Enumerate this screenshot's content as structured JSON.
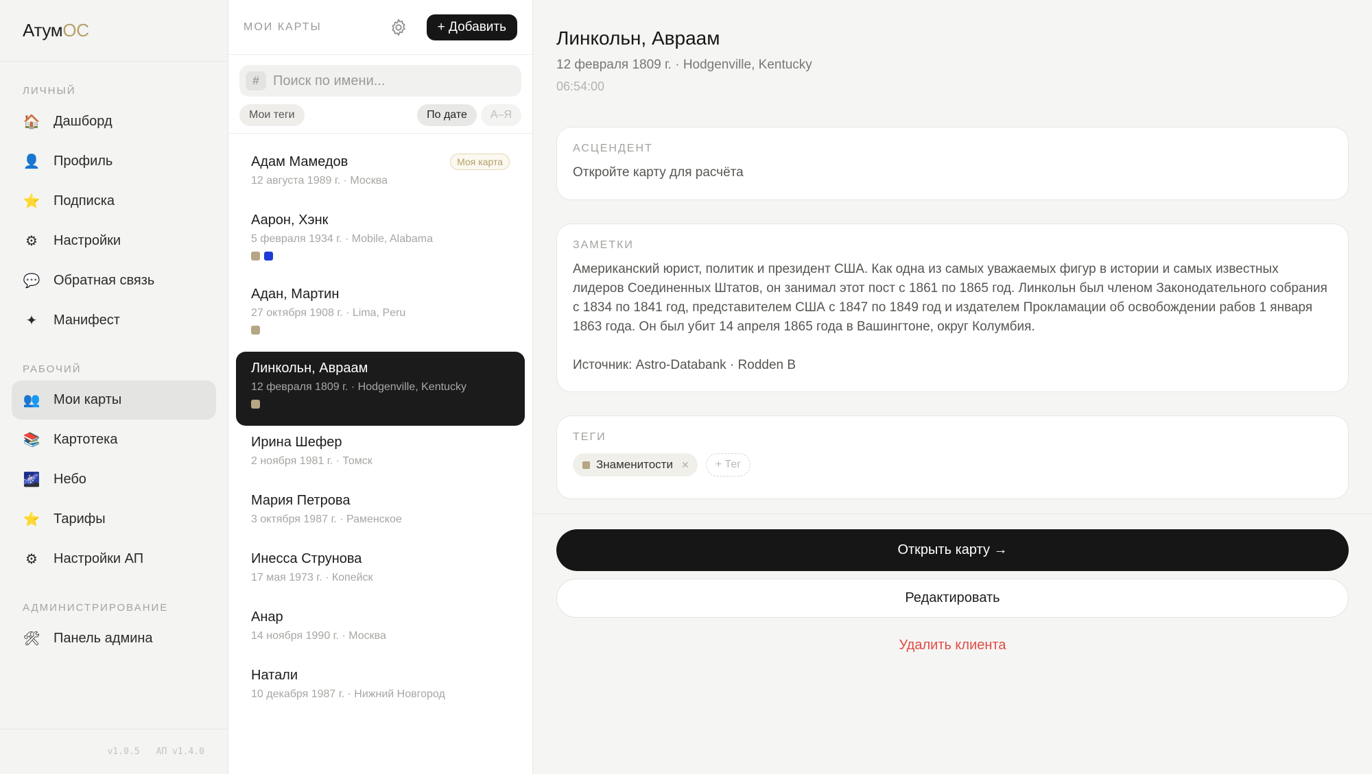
{
  "app": {
    "logo_main": "Атум",
    "logo_accent": "ОС",
    "accent_color": "#b5a06a"
  },
  "sidebar": {
    "sections": [
      {
        "label": "ЛИЧНЫЙ",
        "items": [
          {
            "label": "Дашборд",
            "icon": "house-icon"
          },
          {
            "label": "Профиль",
            "icon": "person-icon"
          },
          {
            "label": "Подписка",
            "icon": "star-icon"
          },
          {
            "label": "Настройки",
            "icon": "gear-icon"
          },
          {
            "label": "Обратная связь",
            "icon": "speech-bubble-icon"
          },
          {
            "label": "Манифест",
            "icon": "sparkle-icon"
          }
        ]
      },
      {
        "label": "РАБОЧИЙ",
        "items": [
          {
            "label": "Мои карты",
            "icon": "people-icon",
            "active": true
          },
          {
            "label": "Картотека",
            "icon": "books-icon"
          },
          {
            "label": "Небо",
            "icon": "night-sky-icon"
          },
          {
            "label": "Тарифы",
            "icon": "star-icon"
          },
          {
            "label": "Настройки АП",
            "icon": "gear-icon"
          }
        ]
      },
      {
        "label": "АДМИНИСТРИРОВАНИЕ",
        "items": [
          {
            "label": "Панель админа",
            "icon": "tools-icon"
          }
        ]
      }
    ],
    "version": "v1.0.5",
    "ap_version": "АП v1.4.0"
  },
  "list": {
    "title": "МОИ КАРТЫ",
    "add_label": "+ Добавить",
    "search_placeholder": "Поиск по имени...",
    "filter_tags": "Мои теги",
    "sort_date": "По дате",
    "sort_az": "А–Я",
    "my_card_badge": "Моя карта",
    "items": [
      {
        "name": "Адам Мамедов",
        "meta": "12 августа 1989 г. · Москва",
        "badge": true,
        "tags": []
      },
      {
        "name": "Аарон, Хэнк",
        "meta": "5 февраля 1934 г. · Mobile, Alabama",
        "tags": [
          "#b5a685",
          "#1f3bd6"
        ]
      },
      {
        "name": "Адан, Мартин",
        "meta": "27 октября 1908 г. · Lima, Peru",
        "tags": [
          "#b5a685"
        ]
      },
      {
        "name": "Линкольн, Авраам",
        "meta": "12 февраля 1809 г. · Hodgenville, Kentucky",
        "tags": [
          "#b5a685"
        ],
        "selected": true
      },
      {
        "name": "Ирина Шефер",
        "meta": "2 ноября 1981 г. · Томск",
        "tags": []
      },
      {
        "name": "Мария Петрова",
        "meta": "3 октября 1987 г. · Раменское",
        "tags": []
      },
      {
        "name": "Инесса Струнова",
        "meta": "17 мая 1973 г. · Копейск",
        "tags": []
      },
      {
        "name": "Анар",
        "meta": "14 ноября 1990 г. · Москва",
        "tags": []
      },
      {
        "name": "Натали",
        "meta": "10 декабря 1987 г. · Нижний Новгород",
        "tags": []
      }
    ]
  },
  "detail": {
    "name": "Линкольн, Авраам",
    "meta": "12 февраля 1809 г. · Hodgenville, Kentucky",
    "time": "06:54:00",
    "ascendant_label": "АСЦЕНДЕНТ",
    "ascendant_text": "Откройте карту для расчёта",
    "notes_label": "ЗАМЕТКИ",
    "notes_text": "Американский юрист, политик и президент США.  Как одна из самых уважаемых фигур в истории и самых известных лидеров Соединенных Штатов, он занимал этот пост с 1861 по 1865 год.  Линкольн был членом Законодательного собрания с 1834 по 1841 год, представителем США с 1847 по 1849 год и издателем Прокламации об освобождении рабов 1 января 1863 года. Он был убит 14 апреля 1865 года в Вашингтоне, округ Колумбия.",
    "source_text": "Источник: Astro-Databank · Rodden B",
    "tags_label": "ТЕГИ",
    "tag": "Знаменитости",
    "tag_color": "#b5a685",
    "tag_add": "+ Тег",
    "open_label": "Открыть карту →",
    "edit_label": "Редактировать",
    "delete_label": "Удалить клиента",
    "delete_color": "#e24b43"
  }
}
